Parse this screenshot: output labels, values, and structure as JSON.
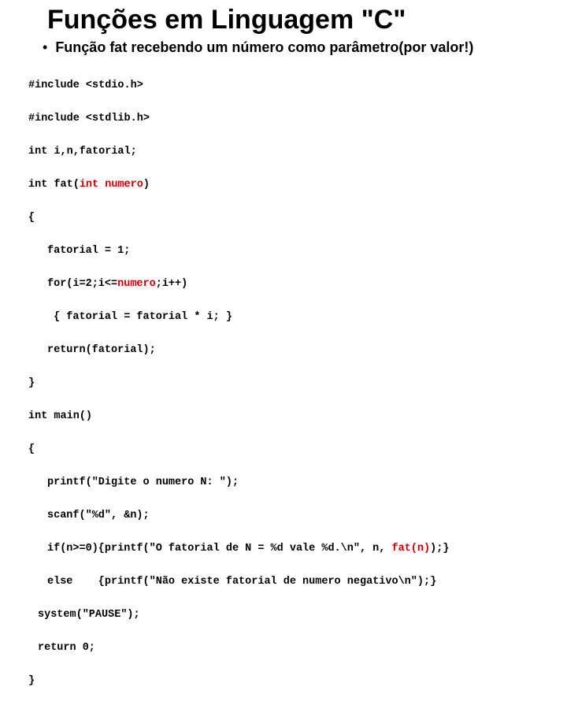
{
  "title": "Funções em Linguagem \"C\"",
  "bullet": "Função fat recebendo um número como parâmetro(por valor!)",
  "code": {
    "l1": "#include <stdio.h>",
    "l2": "#include <stdlib.h>",
    "l3a": "int i,n,fatorial;",
    "l3b_a": "int fat(",
    "l3b_b": "int numero",
    "l3b_c": ")",
    "l4": "{",
    "l5": "fatorial = 1;",
    "l6a": "for(i=2;i<=",
    "l6b": "numero",
    "l6c": ";i++)",
    "l7": " { fatorial = fatorial * i; }",
    "l8": "return(fatorial);",
    "l9": "}",
    "l10": "int main()",
    "l11": "{",
    "l12": "printf(\"Digite o numero N: \");",
    "l13": "scanf(\"%d\", &n);",
    "l14a": "if(n>=0){printf(\"O fatorial de N = %d vale %d.\\n\", n, ",
    "l14b": "fat(n)",
    "l14c": ");}",
    "l15": "else    {printf(\"Não existe fatorial de numero negativo\\n\");}",
    "l16": "system(\"PAUSE\");",
    "l17": "return 0;",
    "l18": "}"
  }
}
